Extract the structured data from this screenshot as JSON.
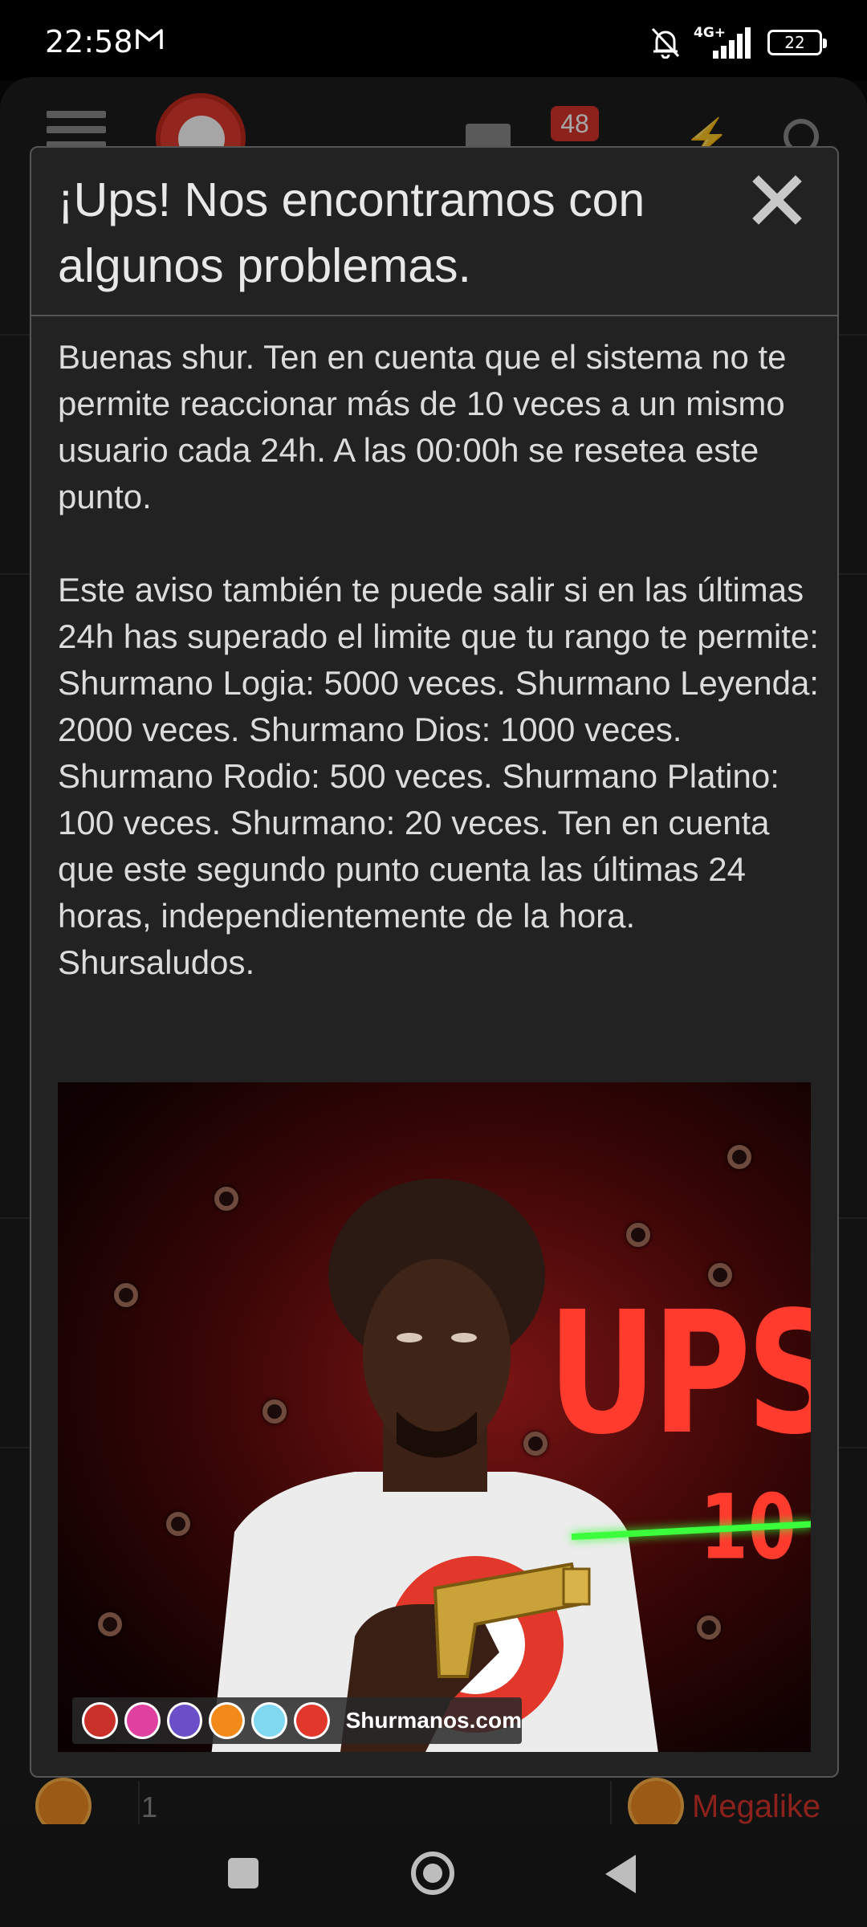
{
  "status_bar": {
    "time": "22:58",
    "network": "4G+",
    "battery": "22"
  },
  "app_bar": {
    "notification_count": "48"
  },
  "dialog": {
    "title": "¡Ups! Nos encontramos con algunos problemas.",
    "paragraphs": [
      "Buenas shur. Ten en cuenta que el sistema no te permite reaccionar más de 10 veces a un mismo usuario cada 24h. A las 00:00h se resetea este punto.",
      "Este aviso también te puede salir si en las últimas 24h has superado el limite que tu rango te permite: Shurmano Logia: 5000 veces. Shurmano Leyenda: 2000 veces. Shurmano Dios: 1000 veces. Shurmano Rodio: 500 veces. Shurmano Platino: 100 veces. Shurmano: 20 veces. Ten en cuenta que este segundo punto cuenta las últimas 24 horas, independientemente de la hora. Shursaludos."
    ],
    "image": {
      "headline": "UPS",
      "number": "10",
      "brand": "Shurmanos.com"
    }
  },
  "reactions": {
    "left_count": "1",
    "right_label": "Megalike"
  },
  "colors": {
    "accent_red": "#d9342b",
    "dialog_bg": "#222222",
    "laser_green": "#3cff3c"
  }
}
